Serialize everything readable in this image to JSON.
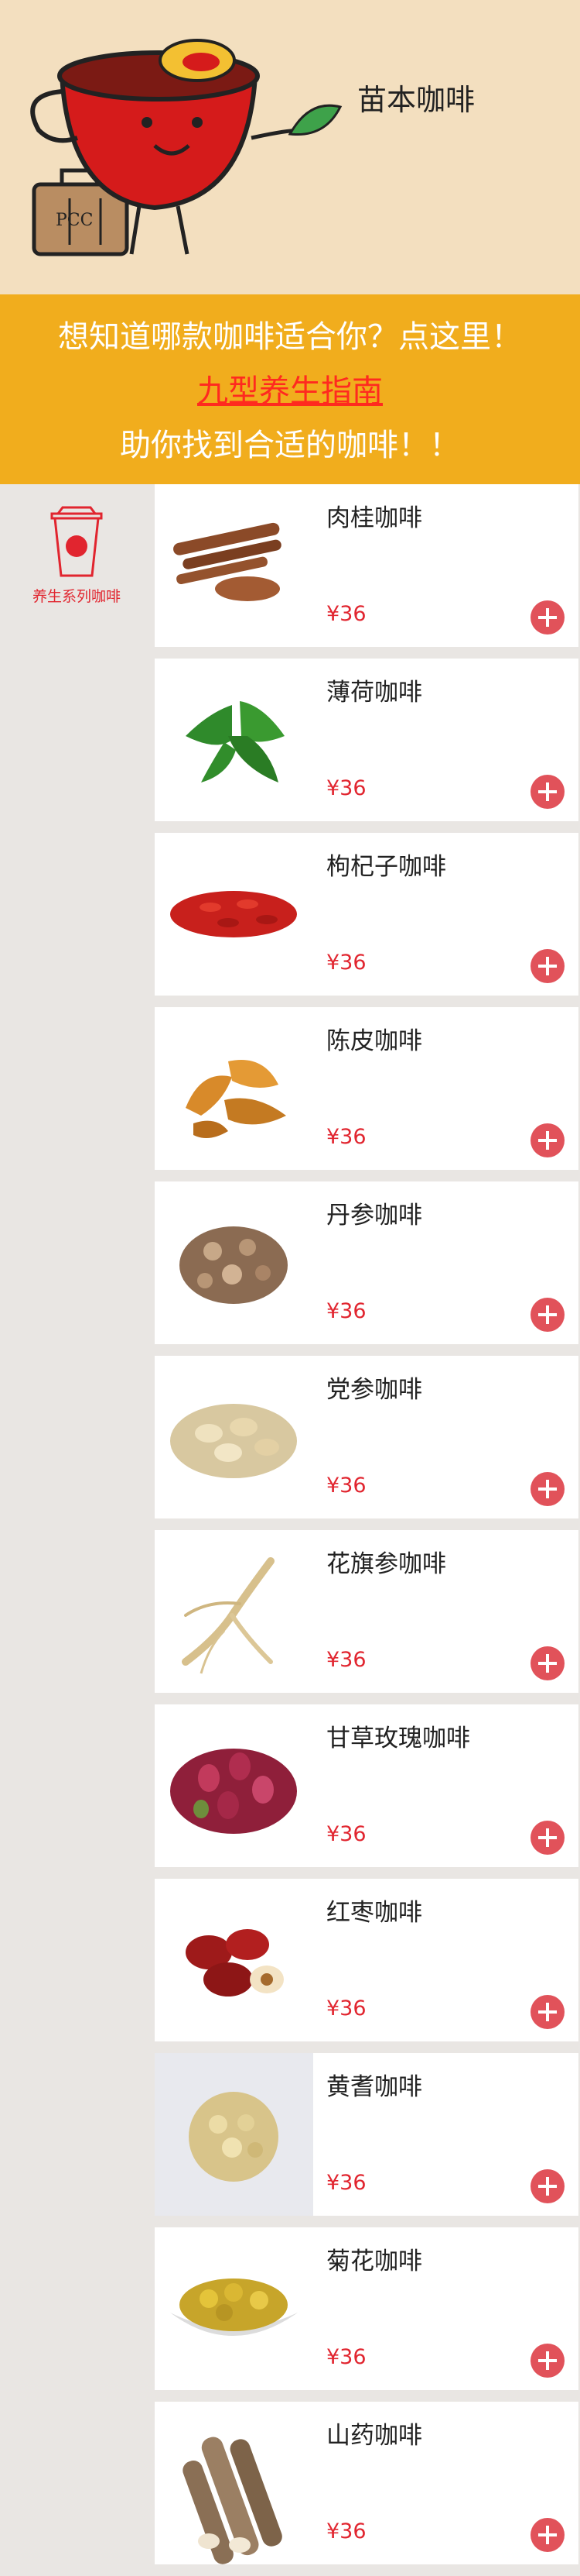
{
  "header": {
    "store_name": "苗本咖啡",
    "mascot_badge": "PCC"
  },
  "banner": {
    "line1": "想知道哪款咖啡适合你？点这里！",
    "line2": "九型养生指南",
    "line3": "助你找到合适的咖啡！！"
  },
  "sidebar": {
    "categories": [
      {
        "label": "养生系列咖啡",
        "icon": "coffee-cup-icon",
        "selected": true
      }
    ]
  },
  "colors": {
    "accent": "#e1252f",
    "add_button": "#e1525a",
    "banner": "#f1ad1d",
    "header": "#f3dfbf"
  },
  "products": [
    {
      "name": "肉桂咖啡",
      "price": "¥36",
      "image": "cinnamon-image"
    },
    {
      "name": "薄荷咖啡",
      "price": "¥36",
      "image": "mint-image"
    },
    {
      "name": "枸杞子咖啡",
      "price": "¥36",
      "image": "goji-image"
    },
    {
      "name": "陈皮咖啡",
      "price": "¥36",
      "image": "tangerine-peel-image"
    },
    {
      "name": "丹参咖啡",
      "price": "¥36",
      "image": "salvia-root-image"
    },
    {
      "name": "党参咖啡",
      "price": "¥36",
      "image": "codonopsis-image"
    },
    {
      "name": "花旗参咖啡",
      "price": "¥36",
      "image": "american-ginseng-image"
    },
    {
      "name": "甘草玫瑰咖啡",
      "price": "¥36",
      "image": "rose-bud-image"
    },
    {
      "name": "红枣咖啡",
      "price": "¥36",
      "image": "red-date-image"
    },
    {
      "name": "黄耆咖啡",
      "price": "¥36",
      "image": "astragalus-image"
    },
    {
      "name": "菊花咖啡",
      "price": "¥36",
      "image": "chrysanthemum-image"
    },
    {
      "name": "山药咖啡",
      "price": "¥36",
      "image": "yam-image"
    }
  ]
}
